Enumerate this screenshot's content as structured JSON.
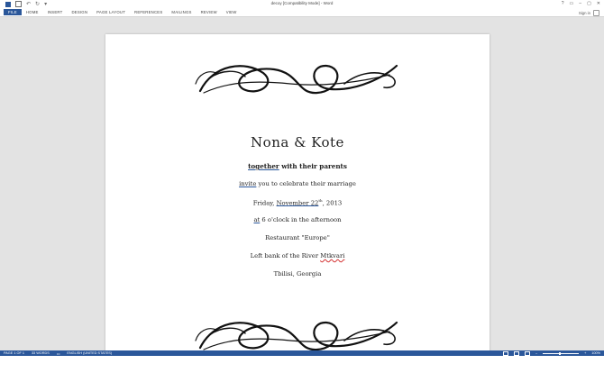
{
  "window": {
    "title": "decoy [Compatibility Mode] - Word",
    "controls": [
      "?",
      "▭",
      "–",
      "▢",
      "✕"
    ]
  },
  "ribbon": {
    "tabs": [
      "FILE",
      "HOME",
      "INSERT",
      "DESIGN",
      "PAGE LAYOUT",
      "REFERENCES",
      "MAILINGS",
      "REVIEW",
      "VIEW"
    ],
    "signin": "Sign in"
  },
  "document": {
    "names": "Nona & Kote",
    "line1_a": "together",
    "line1_b": " with their parents",
    "line2_a": "invite",
    "line2_b": " you to celebrate their marriage",
    "line3_a": "Friday, ",
    "line3_b": "November  22",
    "line3_sup": "th",
    "line3_c": ", 2013",
    "line4_a": "at",
    "line4_b": " 6 o'clock in the afternoon",
    "line5": "Restaurant \"Europe\"",
    "line6_a": "Left bank of the River ",
    "line6_b": "Mtkvari",
    "line7": "Tbilisi, Georgia"
  },
  "status": {
    "page": "PAGE 1 OF 1",
    "words": "33 WORDS",
    "language": "ENGLISH (UNITED STATES)",
    "zoom": "100%"
  },
  "colors": {
    "accent": "#2b579a",
    "spelling": "#d32f2f"
  }
}
